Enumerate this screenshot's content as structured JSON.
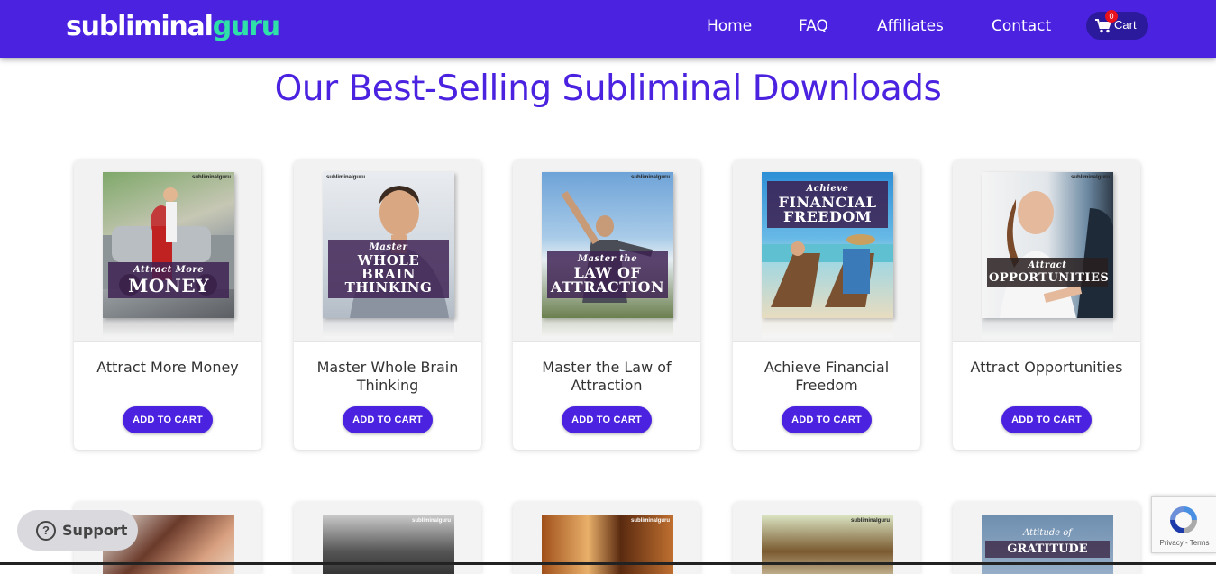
{
  "brand": {
    "part1": "subliminal",
    "part2": "guru"
  },
  "nav": {
    "items": [
      "Home",
      "FAQ",
      "Affiliates",
      "Contact"
    ],
    "cart_label": "Cart",
    "cart_count": "0"
  },
  "page_title": "Our Best-Selling Subliminal Downloads",
  "products": [
    {
      "name": "Attract More Money",
      "cover_sub": "Attract More",
      "cover_main": "MONEY",
      "button": "ADD TO CART"
    },
    {
      "name": "Master Whole Brain Thinking",
      "cover_sub": "Master",
      "cover_main": "WHOLE BRAIN THINKING",
      "button": "ADD TO CART"
    },
    {
      "name": "Master the Law of Attraction",
      "cover_sub": "Master the",
      "cover_main": "LAW OF ATTRACTION",
      "button": "ADD TO CART"
    },
    {
      "name": "Achieve Financial Freedom",
      "cover_sub": "Achieve",
      "cover_main": "FINANCIAL FREEDOM",
      "button": "ADD TO CART"
    },
    {
      "name": "Attract Opportunities",
      "cover_sub": "Attract",
      "cover_main": "OPPORTUNITIES",
      "button": "ADD TO CART"
    }
  ],
  "row2": {
    "cover_brand": "subliminalguru",
    "gratitude_sub": "Attitude of",
    "gratitude_main": "GRATITUDE"
  },
  "support_label": "Support",
  "recaptcha_links": "Privacy - Terms",
  "colors": {
    "primary": "#4a22e0",
    "logo_accent": "#2fe0a9",
    "cart_bg": "#2c1a9c",
    "badge": "#e8121c"
  }
}
